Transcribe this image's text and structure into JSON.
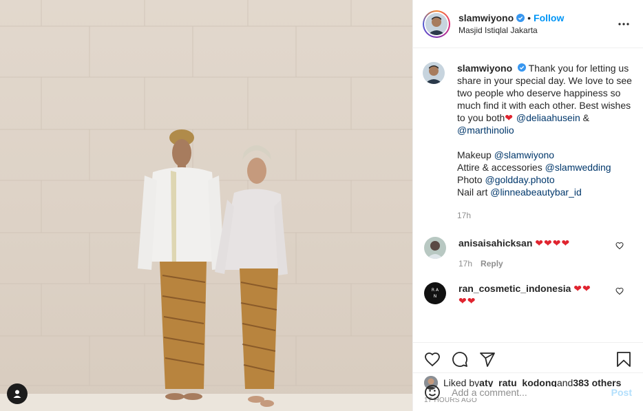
{
  "header": {
    "username": "slamwiyono",
    "separator": "•",
    "follow_label": "Follow",
    "location": "Masjid Istiqlal Jakarta"
  },
  "caption": {
    "username": "slamwiyono",
    "text_1": "Thank you for letting us share in your special day. We love to see two people who deserve happiness so much find it with each other. Best wishes to you both",
    "mention_1": "@deliaahusein",
    "amp": " & ",
    "mention_2": "@marthinolio",
    "credit_makeup_label": "Makeup ",
    "credit_makeup": "@slamwiyono",
    "credit_attire_label": "Attire & accessories ",
    "credit_attire": "@slamwedding",
    "credit_photo_label": "Photo ",
    "credit_photo": "@goldday.photo",
    "credit_nail_label": "Nail art ",
    "credit_nail": "@linneabeautybar_id",
    "time": "17h"
  },
  "comments": [
    {
      "username": "anisaisahicksan",
      "hearts": "❤❤❤❤",
      "time": "17h",
      "reply": "Reply"
    },
    {
      "username": "ran_cosmetic_indonesia",
      "hearts": "❤❤",
      "hearts_2": "❤❤"
    }
  ],
  "likes": {
    "prefix": "Liked by ",
    "user": "aty_ratu_kodong",
    "middle": " and ",
    "count": "383 others"
  },
  "posted_ago": "17 HOURS AGO",
  "add_comment": {
    "placeholder": "Add a comment...",
    "post_label": "Post"
  },
  "icons": {
    "more": "more-horizontal-icon",
    "like": "heart-icon",
    "comment": "comment-icon",
    "share": "share-icon",
    "save": "bookmark-icon",
    "emoji": "emoji-icon",
    "user_tag": "user-tag-icon",
    "verified": "verified-badge-icon"
  },
  "colors": {
    "link": "#0095f6",
    "mention": "#00376b",
    "heart": "#e0242f",
    "muted": "#8e8e8e"
  }
}
